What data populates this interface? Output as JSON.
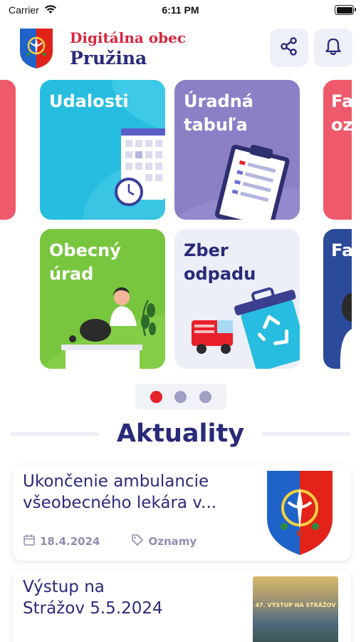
{
  "status_bar": {
    "carrier": "Carrier",
    "time": "6:11 PM",
    "battery_level": 1.0
  },
  "header": {
    "brand_line1": "Digitálna obec",
    "brand_line2": "Pružina",
    "share_icon": "share-icon",
    "bell_icon": "bell-icon"
  },
  "tiles": [
    {
      "label": "Udalosti",
      "color": "#27bde0"
    },
    {
      "label": "Úradná\ntabuľa",
      "color": "#8b80c6"
    },
    {
      "label": "Obecný\núrad",
      "color": "#78c63e"
    },
    {
      "label": "Zber\nodpadu",
      "color": "#eceef8"
    }
  ],
  "partial_tiles": [
    {
      "label": "Fa\noz",
      "color": "#ee5a6b"
    },
    {
      "label": "Fa",
      "color": "#2c4a9a"
    }
  ],
  "pager": {
    "pages": 3,
    "active": 0,
    "active_color": "#e8212b"
  },
  "section": {
    "title": "Aktuality"
  },
  "news": [
    {
      "title": "Ukončenie ambulancie všeobecného lekára v...",
      "date": "18.4.2024",
      "category": "Oznamy"
    },
    {
      "title": "Výstup na\nStrážov 5.5.2024",
      "poster_text": "47. VÝSTUP NA STRÁŽOV"
    }
  ],
  "colors": {
    "primary": "#2a2a7a",
    "accent_red": "#d7263d",
    "muted": "#8f8fb0"
  }
}
